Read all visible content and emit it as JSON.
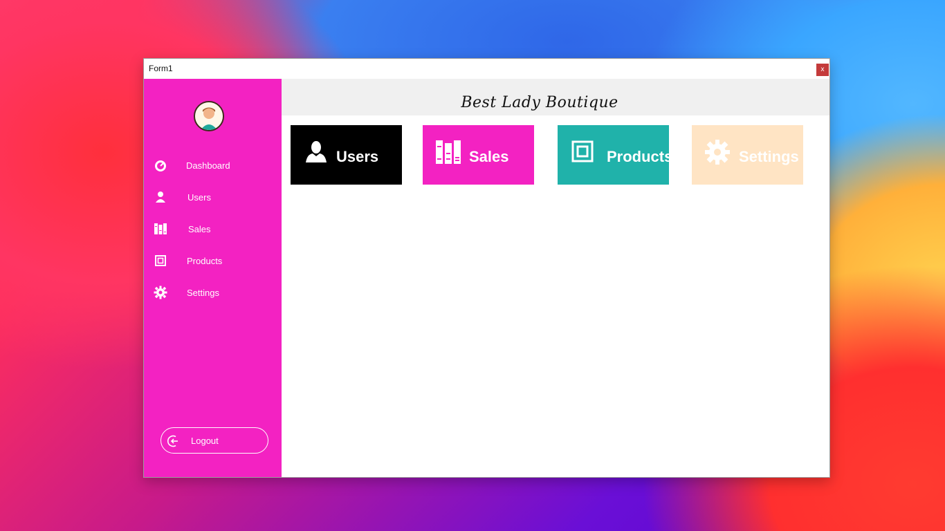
{
  "window": {
    "title": "Form1",
    "close_label": "x"
  },
  "header": {
    "brand": "Best Lady Boutique"
  },
  "sidebar": {
    "items": [
      {
        "label": "Dashboard",
        "icon": "dashboard-icon"
      },
      {
        "label": "Users",
        "icon": "user-icon"
      },
      {
        "label": "Sales",
        "icon": "books-icon"
      },
      {
        "label": "Products",
        "icon": "product-box-icon"
      },
      {
        "label": "Settings",
        "icon": "gear-icon"
      }
    ],
    "logout_label": "Logout"
  },
  "tiles": [
    {
      "label": "Users",
      "color": "#000000",
      "icon": "user-icon"
    },
    {
      "label": "Sales",
      "color": "#f322c2",
      "icon": "books-icon"
    },
    {
      "label": "Products",
      "color": "#20b2aa",
      "icon": "product-box-icon"
    },
    {
      "label": "Settings",
      "color": "#ffe4c4",
      "icon": "gear-icon"
    }
  ],
  "colors": {
    "sidebar": "#f322c2",
    "close": "#c43b3b",
    "header_bg": "#f0f0f0"
  }
}
